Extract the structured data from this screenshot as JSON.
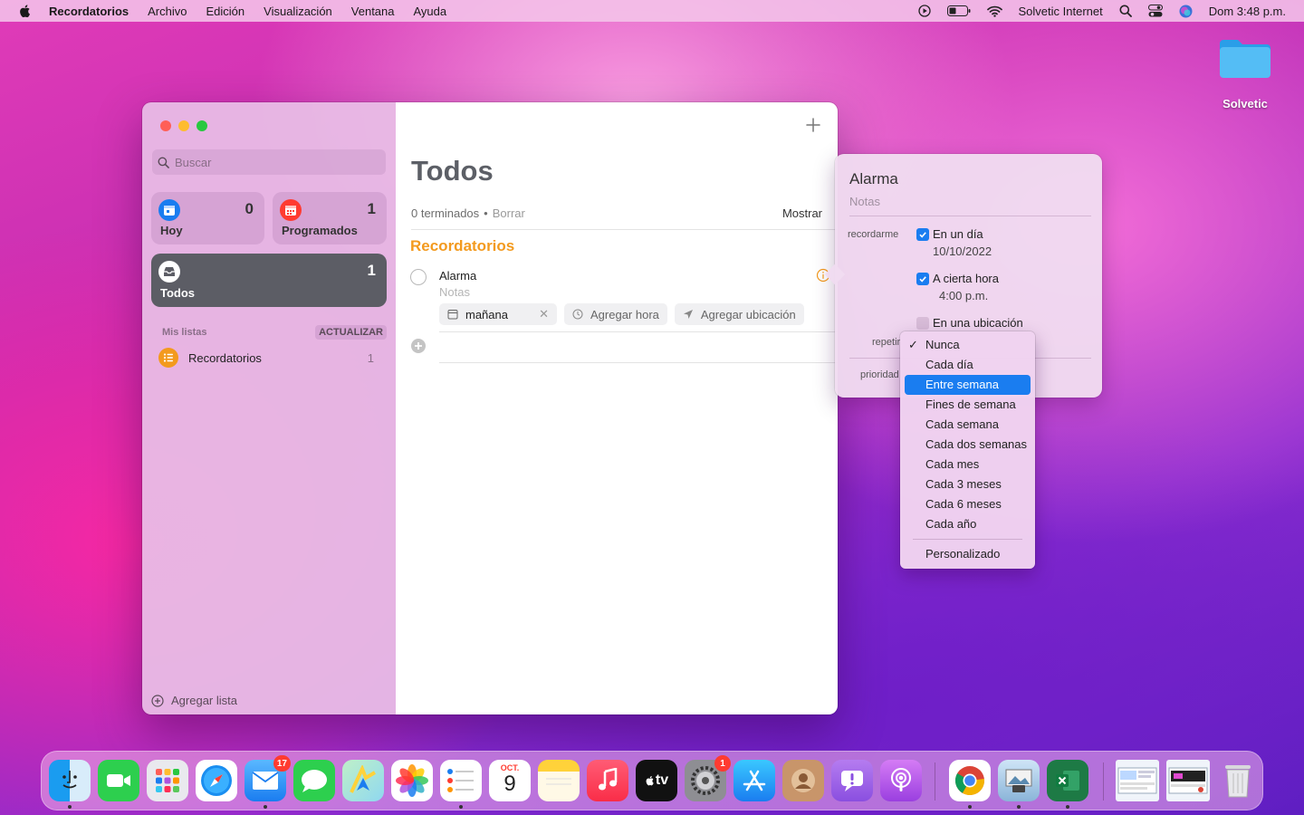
{
  "menubar": {
    "app_name": "Recordatorios",
    "items": [
      "Archivo",
      "Edición",
      "Visualización",
      "Ventana",
      "Ayuda"
    ],
    "wifi_name": "Solvetic Internet",
    "clock": "Dom 3:48 p.m."
  },
  "desktop": {
    "folder_label": "Solvetic"
  },
  "sidebar": {
    "search_placeholder": "Buscar",
    "smart_lists": {
      "hoy": {
        "label": "Hoy",
        "count": "0"
      },
      "programados": {
        "label": "Programados",
        "count": "1"
      },
      "todos": {
        "label": "Todos",
        "count": "1"
      }
    },
    "my_lists_title": "Mis listas",
    "update_button": "ACTUALIZAR",
    "lists": [
      {
        "name": "Recordatorios",
        "count": "1",
        "color": "#f39a1e"
      }
    ],
    "add_list": "Agregar lista"
  },
  "main": {
    "title": "Todos",
    "completed": "0 terminados",
    "clear": "Borrar",
    "show": "Mostrar",
    "section": "Recordatorios",
    "task": {
      "name": "Alarma",
      "notes_placeholder": "Notas",
      "date_chip": "mañana",
      "time_chip": "Agregar hora",
      "location_chip": "Agregar ubicación"
    }
  },
  "popover": {
    "title": "Alarma",
    "notes": "Notas",
    "remind_label": "recordarme",
    "on_day": "En un día",
    "date": "10/10/2022",
    "at_time": "A cierta hora",
    "time": "4:00 p.m.",
    "at_location": "En una ubicación",
    "repeat_label": "repetir",
    "priority_label": "prioridad"
  },
  "repeat_menu": {
    "selected": "Nunca",
    "highlighted": "Entre semana",
    "options": [
      "Nunca",
      "Cada día",
      "Entre semana",
      "Fines de semana",
      "Cada semana",
      "Cada dos semanas",
      "Cada mes",
      "Cada 3 meses",
      "Cada 6 meses",
      "Cada año"
    ],
    "custom": "Personalizado"
  },
  "dock": {
    "mail_badge": "17",
    "settings_badge": "1",
    "calendar_month": "OCT.",
    "calendar_day": "9",
    "tv_label": "tv"
  },
  "colors": {
    "accent": "#1a7df0",
    "orange": "#f39a1e",
    "red": "#ff3b30"
  }
}
